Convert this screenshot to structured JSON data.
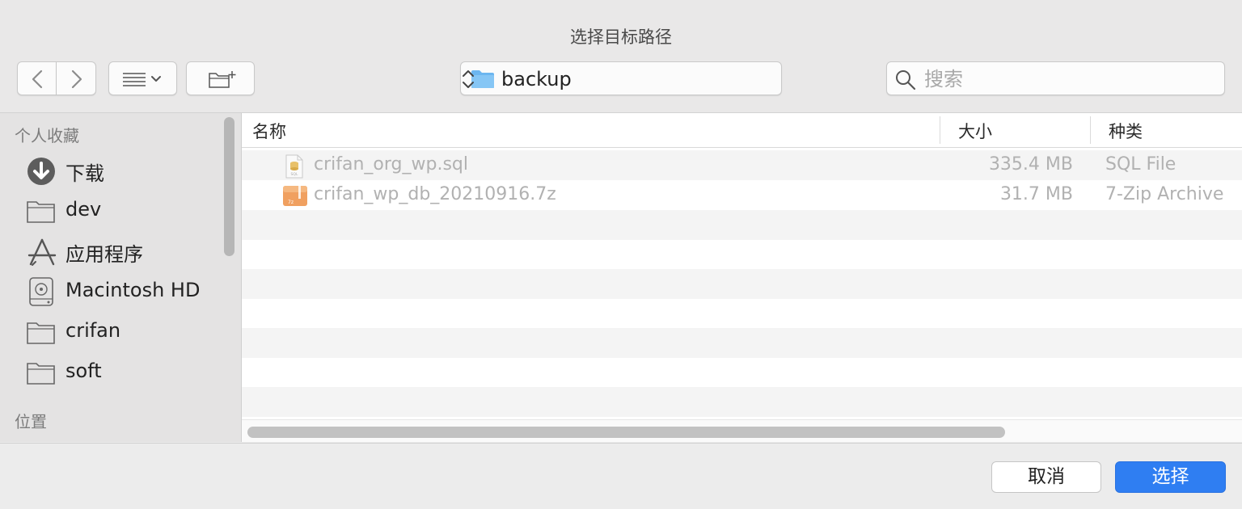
{
  "window": {
    "title": "选择目标路径"
  },
  "toolbar": {
    "location": "backup",
    "search_placeholder": "搜索"
  },
  "sidebar": {
    "favorites_heading": "个人收藏",
    "items": [
      {
        "label": "下载",
        "icon": "download-icon"
      },
      {
        "label": "dev",
        "icon": "folder-icon"
      },
      {
        "label": "应用程序",
        "icon": "applications-icon"
      },
      {
        "label": "Macintosh HD",
        "icon": "hard-drive-icon"
      },
      {
        "label": "crifan",
        "icon": "folder-icon"
      },
      {
        "label": "soft",
        "icon": "folder-icon"
      }
    ],
    "locations_heading": "位置"
  },
  "file_list": {
    "columns": {
      "name": "名称",
      "size": "大小",
      "kind": "种类"
    },
    "rows": [
      {
        "name": "crifan_org_wp.sql",
        "size": "335.4 MB",
        "kind": "SQL File",
        "icon": "sql-file-icon"
      },
      {
        "name": "crifan_wp_db_20210916.7z",
        "size": "31.7 MB",
        "kind": "7-Zip Archive",
        "icon": "archive-icon"
      }
    ]
  },
  "footer": {
    "cancel_label": "取消",
    "choose_label": "选择"
  },
  "colors": {
    "accent": "#2f7ef2",
    "folder": "#6cb6f0"
  }
}
